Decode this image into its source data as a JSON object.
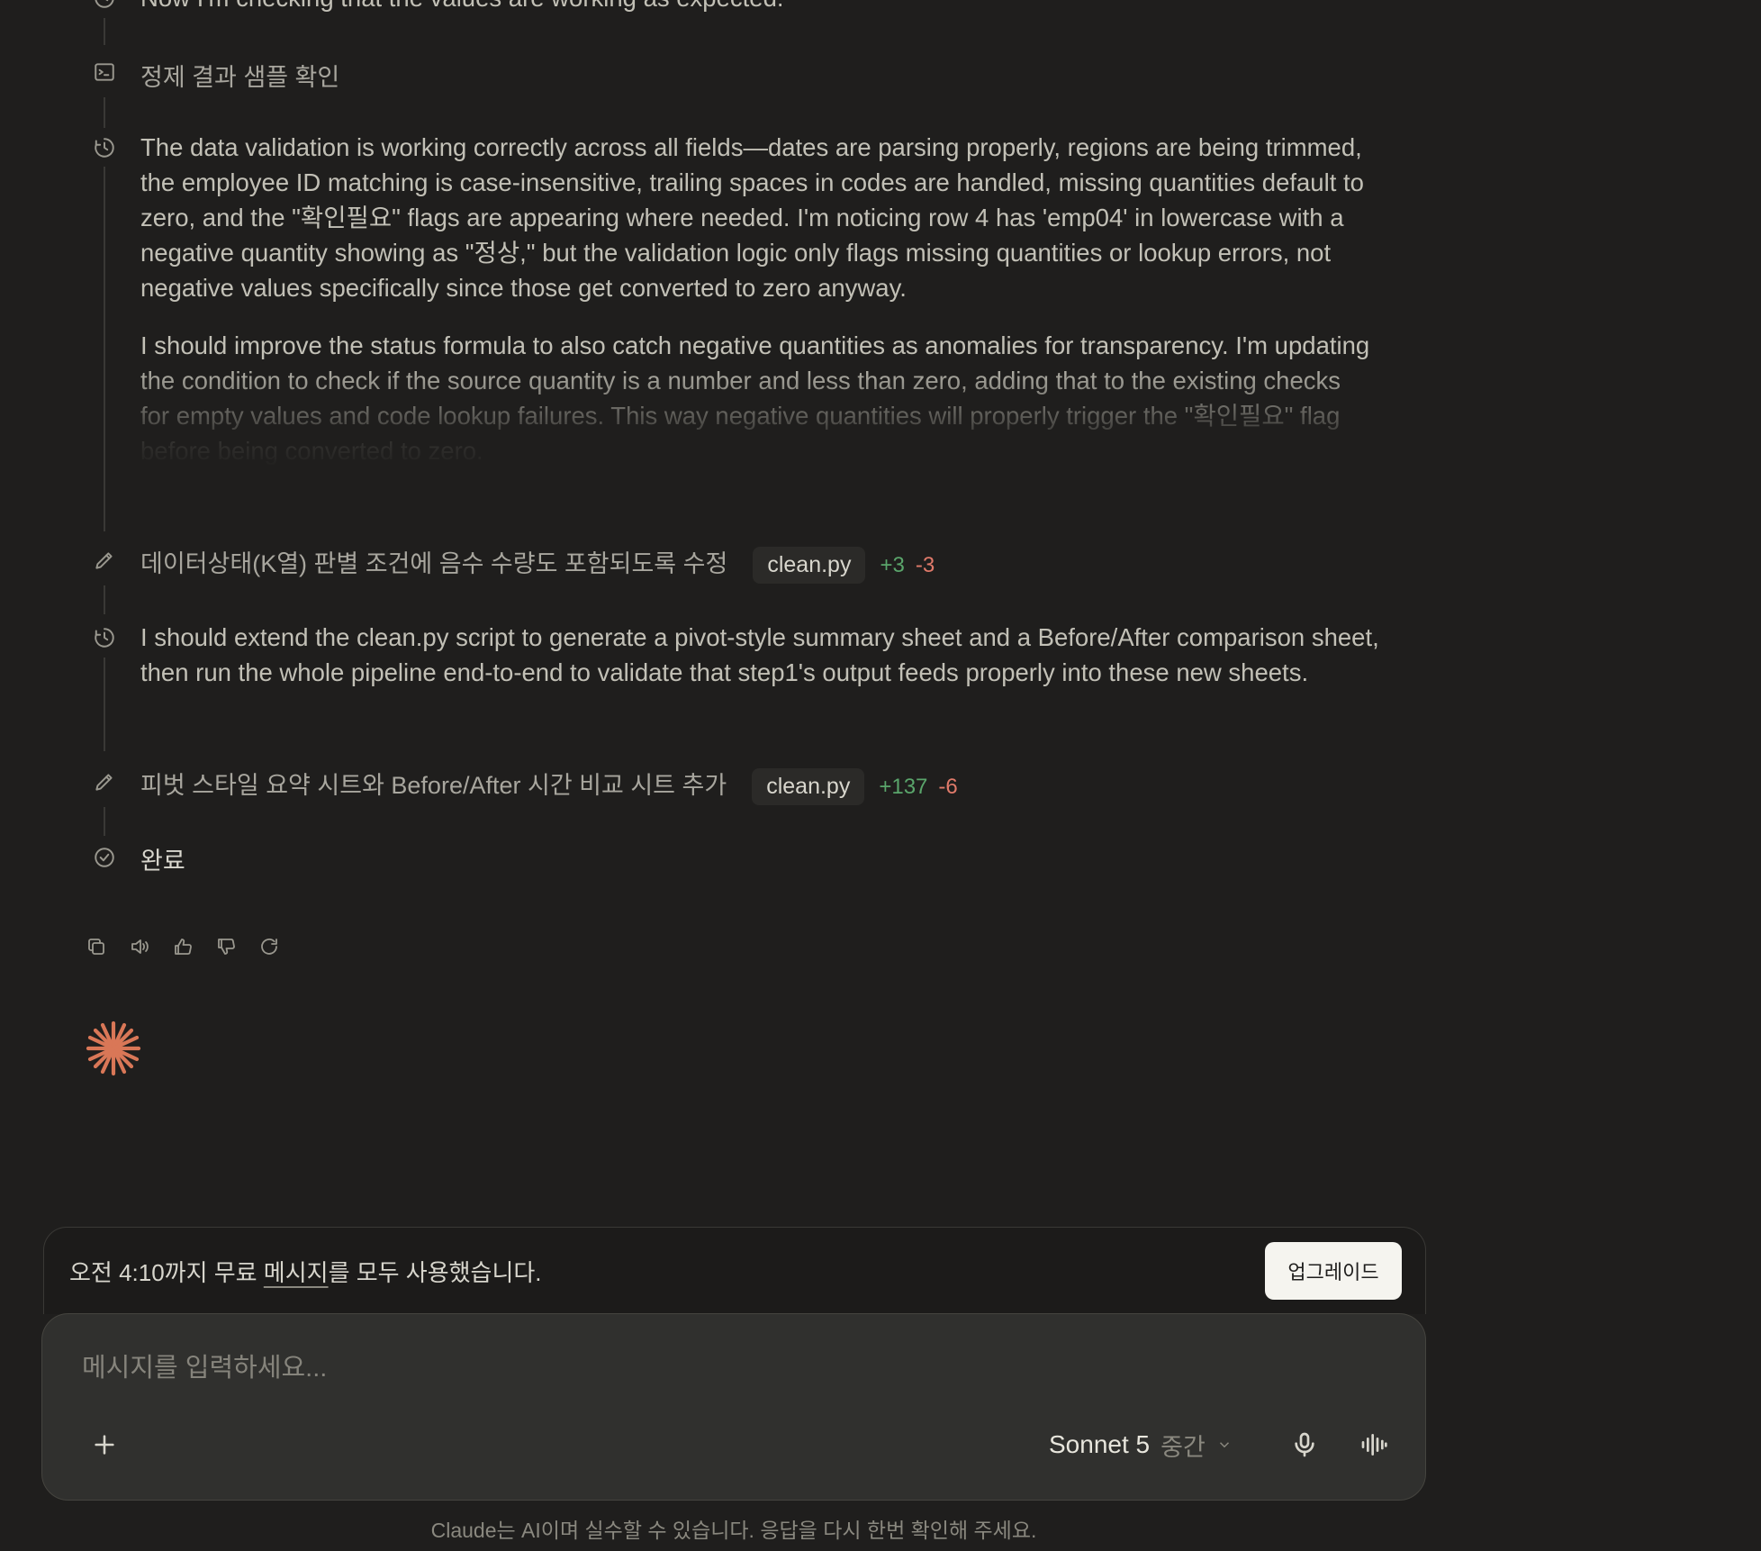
{
  "timeline": {
    "top_step_text": "Now I'm checking that the values are working as expected.",
    "step_sample_check": "정제 결과 샘플 확인",
    "thought1_p1": "The data validation is working correctly across all fields—dates are parsing properly, regions are being trimmed, the employee ID matching is case-insensitive, trailing spaces in codes are handled, missing quantities default to zero, and the \"확인필요\" flags are appearing where needed. I'm noticing row 4 has 'emp04' in lowercase with a negative quantity showing as \"정상,\" but the validation logic only flags missing quantities or lookup errors, not negative values specifically since those get converted to zero anyway.",
    "thought1_p2": "I should improve the status formula to also catch negative quantities as anomalies for transparency. I'm updating the condition to check if the source quantity is a number and less than zero, adding that to the existing checks for empty values and code lookup failures. This way negative quantities will properly trigger the \"확인필요\" flag before being converted to zero.",
    "edit1": {
      "label": "데이터상태(K열) 판별 조건에 음수 수량도 포함되도록 수정",
      "file": "clean.py",
      "added": "+3",
      "removed": "-3"
    },
    "thought2": "I should extend the clean.py script to generate a pivot-style summary sheet and a Before/After comparison sheet, then run the whole pipeline end-to-end to validate that step1's output feeds properly into these new sheets.",
    "edit2": {
      "label": "피벗 스타일 요약 시트와 Before/After 시간 비교 시트 추가",
      "file": "clean.py",
      "added": "+137",
      "removed": "-6"
    },
    "done": "완료"
  },
  "actions": [
    "copy-icon",
    "speaker-icon",
    "thumbs-up-icon",
    "thumbs-down-icon",
    "retry-icon"
  ],
  "notice": {
    "prefix": "오전 4:10까지 무료 ",
    "link": "메시지",
    "suffix": "를 모두 사용했습니다.",
    "upgrade_label": "업그레이드"
  },
  "composer": {
    "placeholder": "메시지를 입력하세요...",
    "model_name": "Sonnet 5",
    "model_level": "중간"
  },
  "disclaimer": "Claude는 AI이며 실수할 수 있습니다. 응답을 다시 한번 확인해 주세요.",
  "colors": {
    "accent": "#d97757",
    "added": "#5aa56b",
    "removed": "#e07a6a",
    "background": "#1f1e1d"
  }
}
